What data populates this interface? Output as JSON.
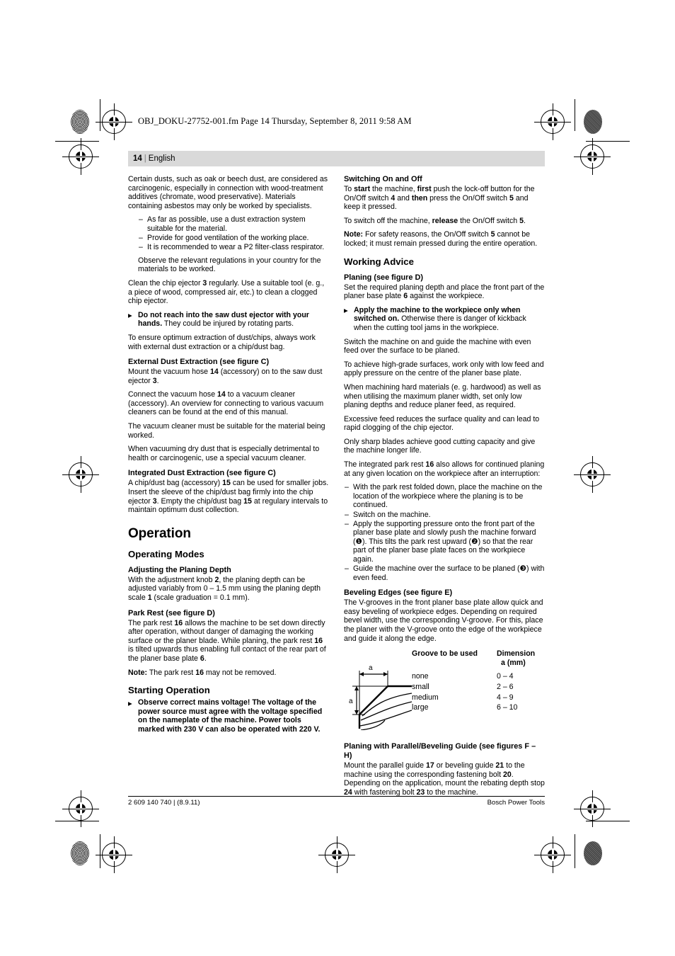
{
  "fm_header": "OBJ_DOKU-27752-001.fm  Page 14  Thursday, September 8, 2011  9:58 AM",
  "runhead": {
    "page_number": "14",
    "separator": "|",
    "language": "English"
  },
  "left_column": {
    "dust_intro": {
      "text_1": "Certain dusts, such as oak or beech dust, are considered as carcinogenic, especially in connection with wood-treatment additives (chromate, wood preservative). Materials containing asbestos may only be worked by specialists.",
      "bullets": [
        "As far as possible, use a dust extraction system suitable for the material.",
        "Provide for good ventilation of the working place.",
        "It is recommended to wear a P2 filter-class respirator."
      ],
      "text_2": "Observe the relevant regulations in your country for the materials to be worked."
    },
    "clean_ejector": {
      "pre": "Clean the chip ejector ",
      "ref": "3",
      "post": " regularly. Use a suitable tool (e. g., a piece of wood, compressed air, etc.) to clean a clogged chip ejector."
    },
    "warning_saw_dust": {
      "bold": "Do not reach into the saw dust ejector with your hands.",
      "rest": " They could be injured by rotating parts."
    },
    "optimum_extraction": "To ensure optimum extraction of dust/chips, always work with external dust extraction or a chip/dust bag.",
    "external_extraction": {
      "heading": "External Dust Extraction (see figure C)",
      "p1_a": "Mount the vacuum hose ",
      "p1_ref1": "14",
      "p1_b": " (accessory) on to the saw dust ejector ",
      "p1_ref2": "3",
      "p1_c": ".",
      "p2_a": "Connect the vacuum hose ",
      "p2_ref1": "14",
      "p2_b": " to a vacuum cleaner (accessory). An overview for connecting to various vacuum cleaners can be found at the end of this manual.",
      "p3": "The vacuum cleaner must be suitable for the material being worked.",
      "p4": "When vacuuming dry dust that is especially detrimental to health or carcinogenic, use a special vacuum cleaner."
    },
    "integrated_extraction": {
      "heading": "Integrated Dust Extraction (see figure C)",
      "p1_a": "A chip/dust bag (accessory) ",
      "p1_ref1": "15",
      "p1_b": " can be used for smaller jobs. Insert the sleeve of the chip/dust bag firmly into the chip ejector ",
      "p1_ref2": "3",
      "p1_c": ". Empty the chip/dust bag ",
      "p1_ref3": "15",
      "p1_d": " at regulary intervals to maintain optimum dust collection."
    },
    "operation_heading": "Operation",
    "operating_modes_heading": "Operating Modes",
    "planing_depth": {
      "heading": "Adjusting the Planing Depth",
      "p_a": "With the adjustment knob ",
      "p_ref1": "2",
      "p_b": ", the planing depth can be adjusted variably from 0 – 1.5 mm using the planing depth scale ",
      "p_ref2": "1",
      "p_c": " (scale graduation = 0.1 mm)."
    },
    "park_rest": {
      "heading": "Park Rest (see figure D)",
      "p_a": "The park rest ",
      "p_ref1": "16",
      "p_b": " allows the machine to be set down directly after operation, without danger of damaging the working surface or the planer blade. While planing, the park rest ",
      "p_ref2": "16",
      "p_c": " is tilted upwards thus enabling full contact of the rear part of the planer base plate ",
      "p_ref3": "6",
      "p_d": ".",
      "note_label": "Note:",
      "note_a": " The park rest ",
      "note_ref": "16",
      "note_b": " may not be removed."
    },
    "starting_operation": {
      "heading": "Starting Operation",
      "warning": "Observe correct mains voltage! The voltage of the power source must agree with the voltage specified on the nameplate of the machine. Power tools marked with 230 V can also be operated with 220 V."
    }
  },
  "right_column": {
    "switching": {
      "heading": "Switching On and Off",
      "p1_a": "To ",
      "p1_b1": "start",
      "p1_b": " the machine, ",
      "p1_b2": "first",
      "p1_c": " push the lock-off button for the On/Off switch ",
      "p1_ref1": "4",
      "p1_d": " and ",
      "p1_b3": "then",
      "p1_e": " press the On/Off switch ",
      "p1_ref2": "5",
      "p1_f": " and keep it pressed.",
      "p2_a": "To switch off the machine, ",
      "p2_b1": "release",
      "p2_b": " the On/Off switch ",
      "p2_ref": "5",
      "p2_c": ".",
      "note_label": "Note:",
      "note_a": " For safety reasons, the On/Off switch ",
      "note_ref": "5",
      "note_b": " cannot be locked; it must remain pressed during the entire operation."
    },
    "working_advice_heading": "Working Advice",
    "planing": {
      "heading": "Planing (see figure D)",
      "p1_a": "Set the required planing depth and place the front part of the planer base plate ",
      "p1_ref": "6",
      "p1_b": " against the workpiece.",
      "warning_bold": "Apply the machine to the workpiece only when switched on.",
      "warning_rest": " Otherwise there is danger of kickback when the cutting tool jams in the workpiece.",
      "p2": "Switch the machine on and guide the machine with even feed over the surface to be planed.",
      "p3": "To achieve high-grade surfaces, work only with low feed and apply pressure on the centre of the planer base plate.",
      "p4": "When machining hard materials (e. g. hardwood) as well as when utilising the maximum planer width, set only low planing depths and reduce planer feed, as required.",
      "p5": "Excessive feed reduces the surface quality and can lead to rapid clogging of the chip ejector.",
      "p6": "Only sharp blades achieve good cutting capacity and give the machine longer life.",
      "p7_a": "The integrated park rest ",
      "p7_ref": "16",
      "p7_b": " also allows for continued planing at any given location on the workpiece after an interruption:",
      "steps": [
        "With the park rest folded down, place the machine on the location of the workpiece where the planing is to be continued.",
        "Switch on the machine.",
        "Apply the supporting pressure onto the front part of the planer base plate and slowly push the machine forward (❶). This tilts the park rest upward (❷) so that the rear part of the planer base plate faces on the workpiece again.",
        "Guide the machine over the surface to be planed (❸) with even feed."
      ]
    },
    "beveling": {
      "heading": "Beveling Edges (see figure E)",
      "p1": "The V-grooves in the front planer base plate allow quick and easy beveling of workpiece edges. Depending on required bevel width, use the corresponding V-groove. For this, place the planer with the V-groove onto the edge of the workpiece and guide it along the edge.",
      "figure_label_top": "a",
      "figure_label_left": "a",
      "table": {
        "header_1": "Groove to be used",
        "header_2_line1": "Dimension",
        "header_2_line2": "a (mm)",
        "rows": [
          {
            "groove": "none",
            "dimension": "0 – 4"
          },
          {
            "groove": "small",
            "dimension": "2 – 6"
          },
          {
            "groove": "medium",
            "dimension": "4 – 9"
          },
          {
            "groove": "large",
            "dimension": "6 – 10"
          }
        ]
      }
    },
    "parallel_guide": {
      "heading": "Planing with Parallel/Beveling Guide (see figures F – H)",
      "p_a": "Mount the parallel guide ",
      "p_ref1": "17",
      "p_b": " or beveling guide ",
      "p_ref2": "21",
      "p_c": " to the machine using the corresponding fastening bolt ",
      "p_ref3": "20",
      "p_d": ". Depending on the application, mount the rebating depth stop ",
      "p_ref4": "24",
      "p_e": " with fastening bolt ",
      "p_ref5": "23",
      "p_f": " to the machine."
    }
  },
  "footer": {
    "left": "2 609 140 740 | (8.9.11)",
    "right": "Bosch Power Tools"
  }
}
